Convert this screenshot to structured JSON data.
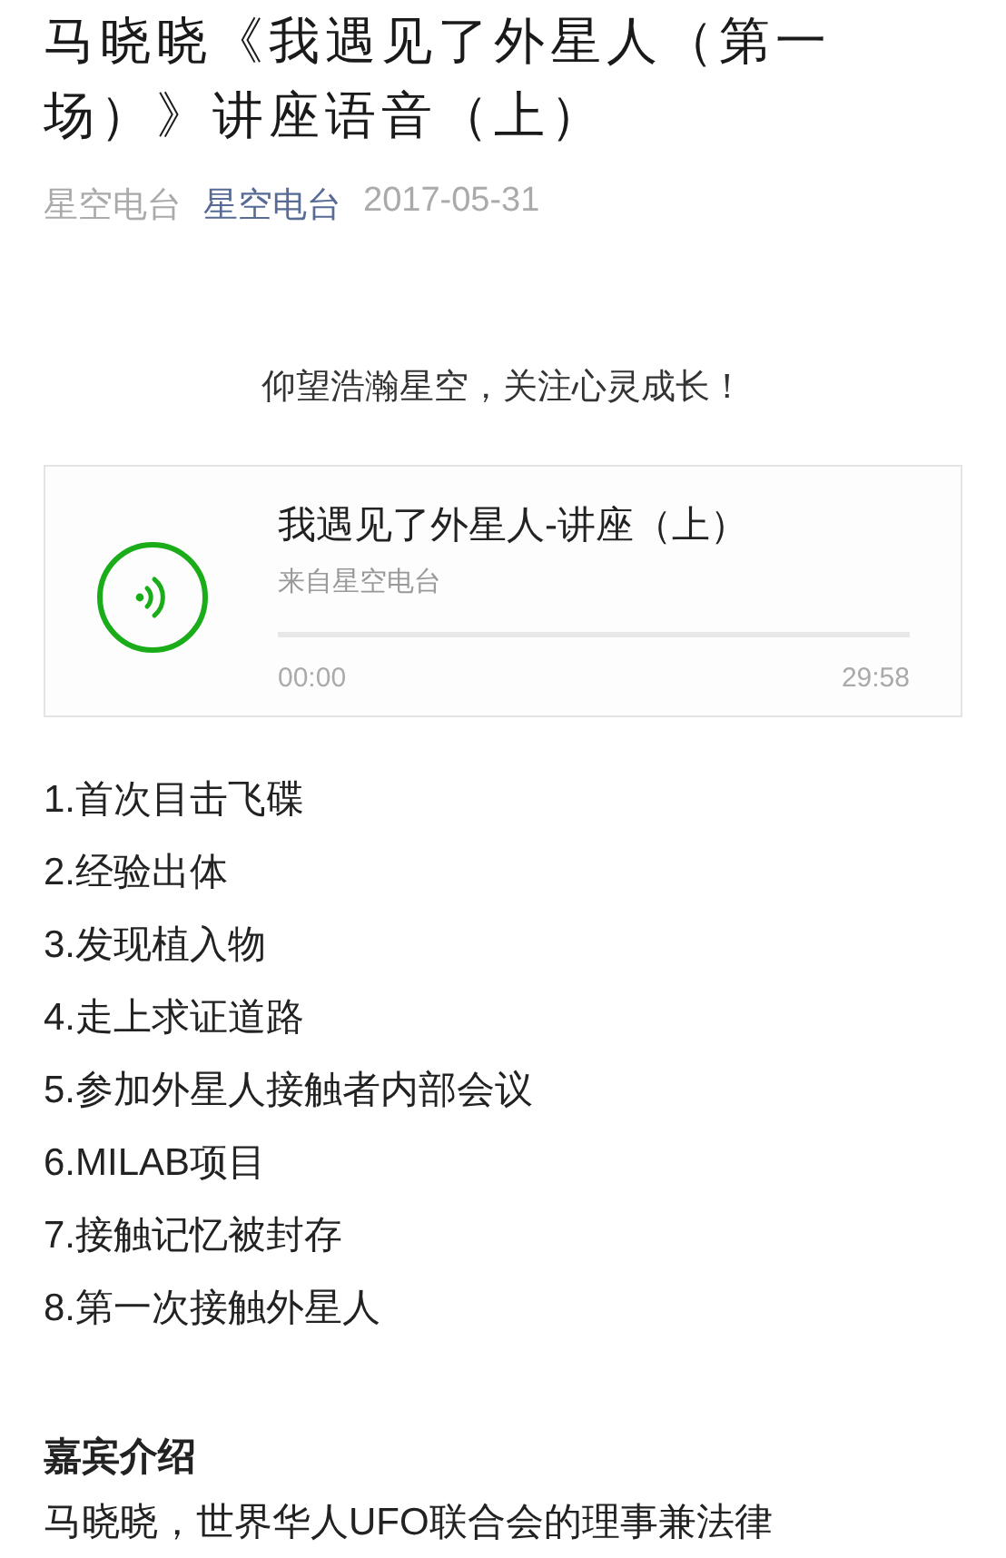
{
  "article": {
    "title": "马晓晓《我遇见了外星人（第一场）》讲座语音（上）",
    "meta": {
      "author": "星空电台",
      "account": "星空电台",
      "date": "2017-05-31"
    },
    "tagline": "仰望浩瀚星空，关注心灵成长！",
    "audio": {
      "title": "我遇见了外星人-讲座（上）",
      "source": "来自星空电台",
      "level": 0,
      "elapsed": "00:00",
      "duration": "29:58"
    },
    "outline": [
      "1.首次目击飞碟",
      "2.经验出体",
      "3.发现植入物",
      "4.走上求证道路",
      "5.参加外星人接触者内部会议",
      "6.MILAB项目",
      "7.接触记忆被封存",
      "8.第一次接触外星人"
    ],
    "section_heading": "嘉宾介绍",
    "section_text": "马晓晓，世界华人UFO联合会的理事兼法律"
  }
}
